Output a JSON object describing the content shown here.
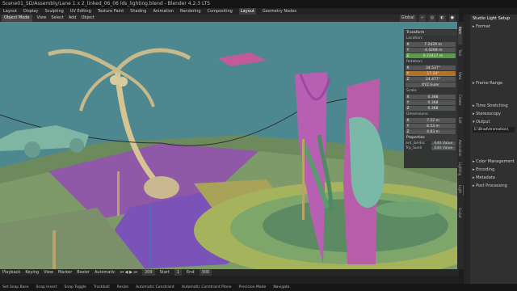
{
  "window": {
    "title": "Scene01_SD/Assembly/Lane 1 x 2_linked_06_06 lds_lighting.blend - Blender 4.2.3 LTS"
  },
  "workspaces": [
    "Layout",
    "Display",
    "Sculpting",
    "UV Editing",
    "Texture Paint",
    "Shading",
    "Animation",
    "Rendering",
    "Compositing",
    "Layout",
    "Geometry Nodes"
  ],
  "active_workspace_index": 9,
  "viewport_header": {
    "mode": "Object Mode",
    "menus": [
      "View",
      "Select",
      "Add",
      "Object"
    ],
    "transform_orientation": "Global"
  },
  "npanel": {
    "transform_title": "Transform",
    "location_label": "Location:",
    "location": {
      "x": "7.2429 m",
      "y": "-4.0268 m",
      "z": "0.72417 m"
    },
    "rotation_label": "Rotation:",
    "rotation": {
      "x": "34.537°",
      "y": "17.24°",
      "z": "24.477°"
    },
    "rotation_mode": "XYZ Euler",
    "scale_label": "Scale:",
    "scale": {
      "x": "0.368",
      "y": "0.368",
      "z": "0.368"
    },
    "dimensions_label": "Dimensions:",
    "dimensions": {
      "x": "7.22 m",
      "y": "8.53 m",
      "z": "4.83 m"
    },
    "properties_title": "Properties",
    "prop_rows": [
      {
        "name": "ant_landsc",
        "button": "Edit Value"
      },
      {
        "name": "Trp_Sunli",
        "button": "Edit Value"
      }
    ]
  },
  "side_tabs": [
    "Item",
    "Tool",
    "View",
    "Create",
    "Edit",
    "Animation",
    "Lighting",
    "Studio Light",
    "Sculpt"
  ],
  "properties_panel": {
    "title": "Studio Light Setup",
    "sections": [
      "Format",
      "Frame Range",
      "Time Stretching",
      "Stereoscopy",
      "Output"
    ],
    "output_path": "E:\\Brad\\Animation\\",
    "lower_sections": [
      "Color Management",
      "Encoding",
      "Metadata",
      "Post Processing"
    ]
  },
  "timeline": {
    "menus": [
      "Playback",
      "Keying",
      "View",
      "Marker"
    ],
    "interp": "Bezier",
    "mode": "Automatic",
    "current_frame": "209",
    "start_label": "Start",
    "start": "1",
    "end_label": "End",
    "end": "300"
  },
  "status_bar": [
    "Set Snap Base",
    "Snap Invert",
    "Snap Toggle",
    "Trackball",
    "Resize",
    "Automatic Constraint",
    "Automatic Constraint Plane",
    "Precision Mode",
    "Navigate"
  ]
}
